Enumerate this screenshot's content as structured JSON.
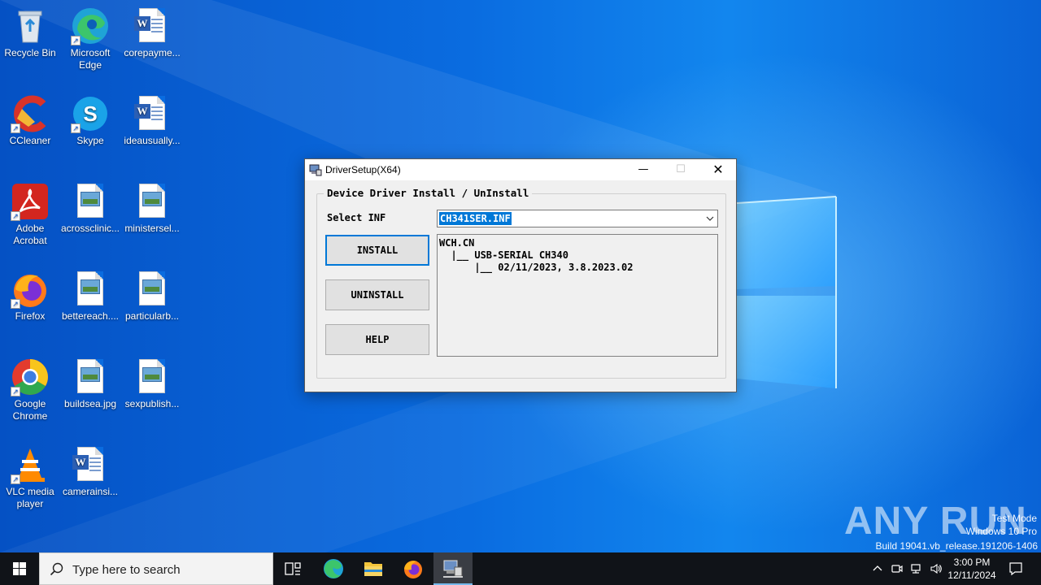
{
  "desktop": {
    "icons": [
      {
        "label": "Recycle Bin"
      },
      {
        "label": "Microsoft Edge"
      },
      {
        "label": "corepayme..."
      },
      {
        "label": "CCleaner"
      },
      {
        "label": "Skype"
      },
      {
        "label": "ideausually..."
      },
      {
        "label": "Adobe Acrobat"
      },
      {
        "label": "acrossclinic..."
      },
      {
        "label": "ministersel..."
      },
      {
        "label": "Firefox"
      },
      {
        "label": "bettereach...."
      },
      {
        "label": "particularb..."
      },
      {
        "label": "Google Chrome"
      },
      {
        "label": "buildsea.jpg"
      },
      {
        "label": "sexpublish..."
      },
      {
        "label": "VLC media player"
      },
      {
        "label": "camerainsi..."
      }
    ],
    "watermark": {
      "brand": "ANY RUN",
      "line1": "Test Mode",
      "line2": "Windows 10 Pro",
      "line3": "Build 19041.vb_release.191206-1406"
    }
  },
  "dialog": {
    "title": "DriverSetup(X64)",
    "group_title": "Device Driver Install / UnInstall",
    "select_label": "Select INF",
    "inf_value": "CH341SER.INF",
    "buttons": {
      "install": "INSTALL",
      "uninstall": "UNINSTALL",
      "help": "HELP"
    },
    "info_lines": [
      "WCH.CN",
      "  |__ USB-SERIAL CH340",
      "      |__ 02/11/2023, 3.8.2023.02"
    ]
  },
  "taskbar": {
    "search_placeholder": "Type here to search",
    "time": "3:00 PM",
    "date": "12/11/2024"
  },
  "colors": {
    "accent": "#0078d7",
    "taskbar": "#101318",
    "wallpaper": "#0a6ce0"
  }
}
